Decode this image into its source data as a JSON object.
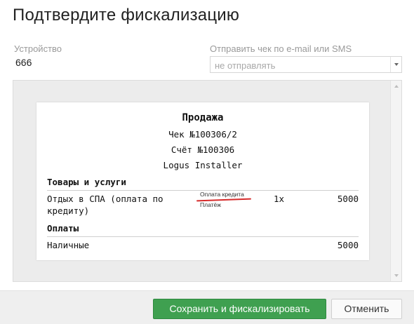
{
  "dialog": {
    "title": "Подтвердите фискализацию"
  },
  "device": {
    "label": "Устройство",
    "value": "666"
  },
  "send_receipt": {
    "label": "Отправить чек по e-mail или SMS",
    "selected": "не отправлять"
  },
  "receipt": {
    "heading": "Продажа",
    "check_number": "Чек №100306/2",
    "invoice_number": "Счёт №100306",
    "operator": "Logus Installer",
    "goods_section": "Товары и услуги",
    "items": [
      {
        "name_line1": "Отдых в СПА (оплата по",
        "name_line2": "кредиту)",
        "tag": "Оплата кредита",
        "subtag": "Платёж",
        "qty": "1x",
        "amount": "5000"
      }
    ],
    "payments_section": "Оплаты",
    "payments": [
      {
        "method": "Наличные",
        "amount": "5000"
      }
    ]
  },
  "footer": {
    "save_label": "Сохранить и фискализировать",
    "cancel_label": "Отменить"
  },
  "colors": {
    "primary": "#3fa050",
    "annotation": "#d62b2b"
  }
}
